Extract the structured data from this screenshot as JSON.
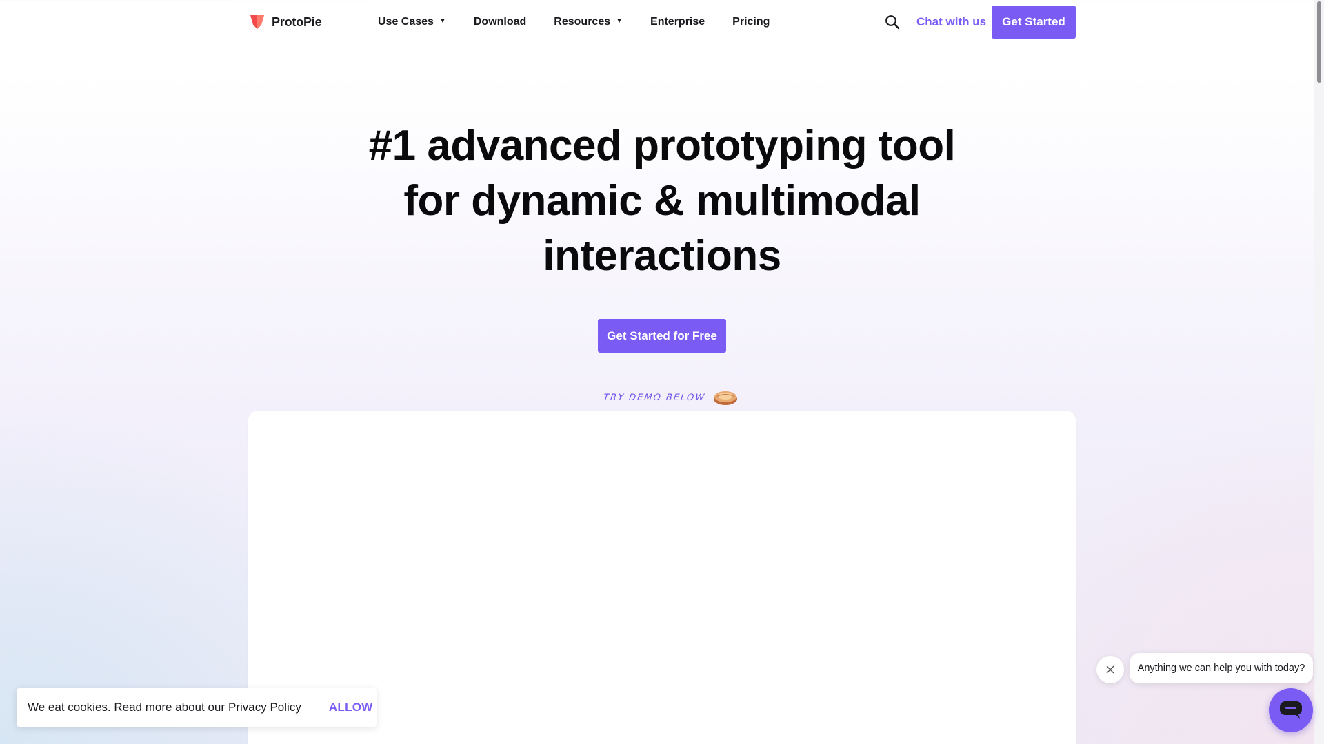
{
  "header": {
    "logo_text": "ProtoPie",
    "nav": [
      {
        "label": "Use Cases",
        "has_dropdown": true
      },
      {
        "label": "Download",
        "has_dropdown": false
      },
      {
        "label": "Resources",
        "has_dropdown": true
      },
      {
        "label": "Enterprise",
        "has_dropdown": false
      },
      {
        "label": "Pricing",
        "has_dropdown": false
      }
    ],
    "search_icon": "search-icon",
    "chat_link": "Chat with us",
    "cta": "Get Started"
  },
  "hero": {
    "headline_lines": [
      "#1 advanced prototyping tool",
      "for dynamic & multimodal",
      "interactions"
    ],
    "cta": "Get Started for Free",
    "demo_hint": "Try demo below"
  },
  "cookie_banner": {
    "text": "We eat cookies. Read more about our",
    "link": "Privacy Policy",
    "allow": "ALLOW"
  },
  "chat_widget": {
    "message": "Anything we can help you with today?"
  },
  "colors": {
    "accent": "#7a5cf5",
    "logo": "#f24b4b",
    "text": "#0a0a0c"
  }
}
